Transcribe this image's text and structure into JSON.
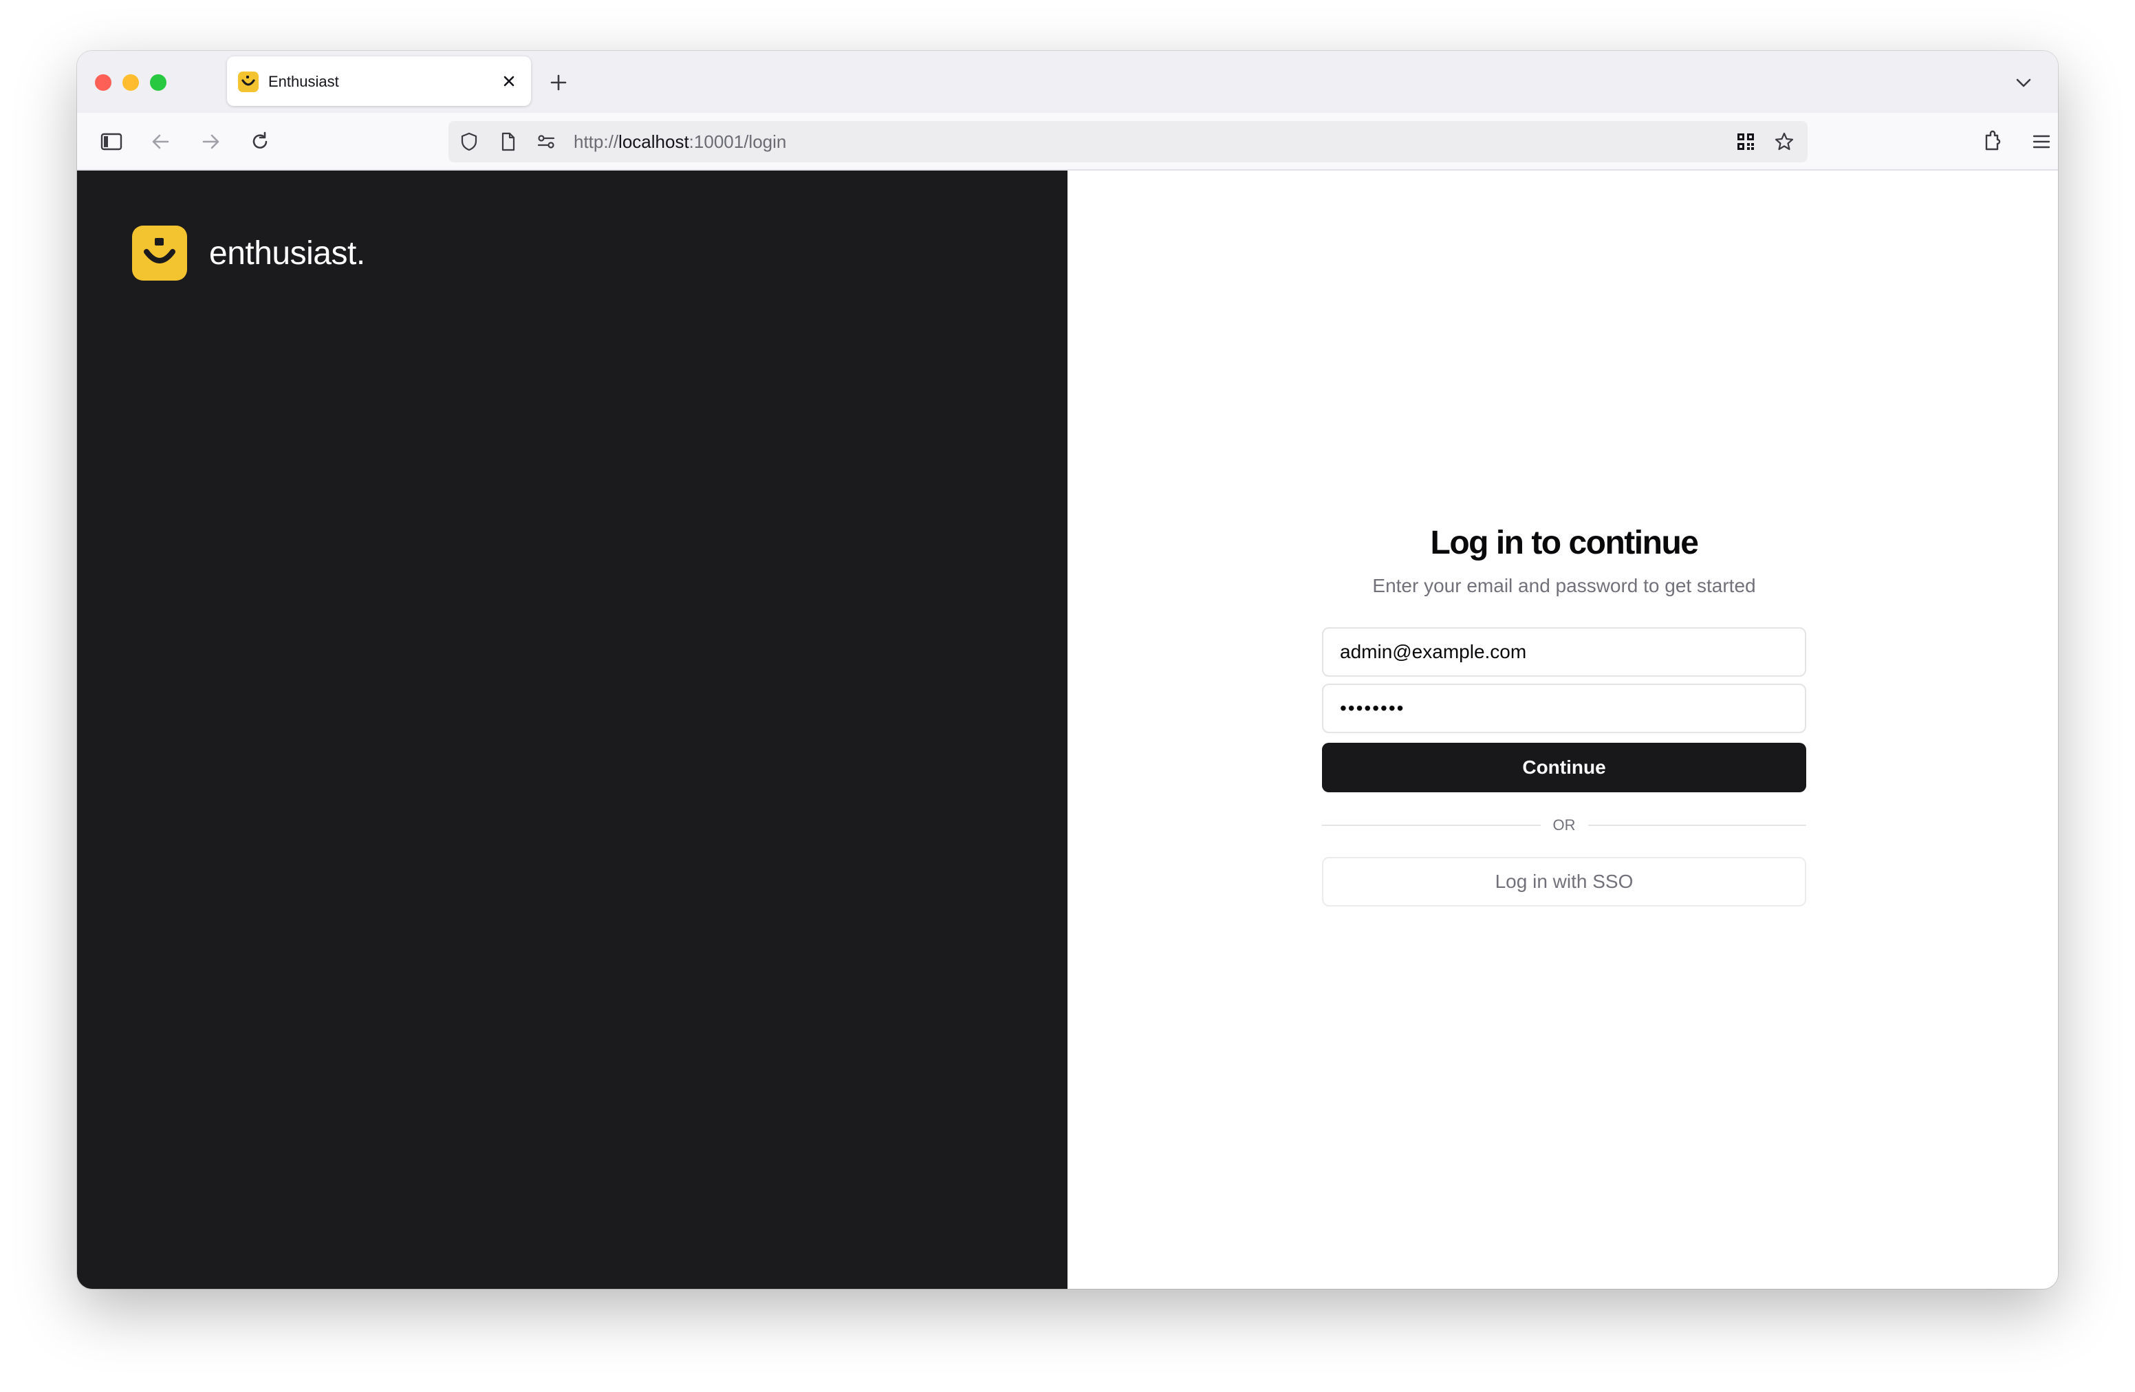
{
  "browser": {
    "tab": {
      "title": "Enthusiast",
      "favicon": "enthusiast-logo-icon"
    },
    "url": {
      "scheme": "http://",
      "host": "localhost",
      "rest": ":10001/login"
    },
    "toolbar_icons": [
      "sidebar-icon",
      "back-arrow-icon",
      "forward-arrow-icon",
      "reload-icon"
    ],
    "url_icons": [
      "shield-icon",
      "page-icon",
      "permissions-icon",
      "qr-code-icon",
      "bookmark-star-icon"
    ],
    "right_icons": [
      "extensions-icon",
      "hamburger-menu-icon"
    ]
  },
  "brand": {
    "name": "enthusiast.",
    "accent_color": "#f4c430",
    "panel_color": "#1b1b1d"
  },
  "login": {
    "title": "Log in to continue",
    "subtitle": "Enter your email and password to get started",
    "email_value": "admin@example.com",
    "password_value": "••••••••",
    "continue_label": "Continue",
    "divider_label": "OR",
    "sso_label": "Log in with SSO"
  }
}
